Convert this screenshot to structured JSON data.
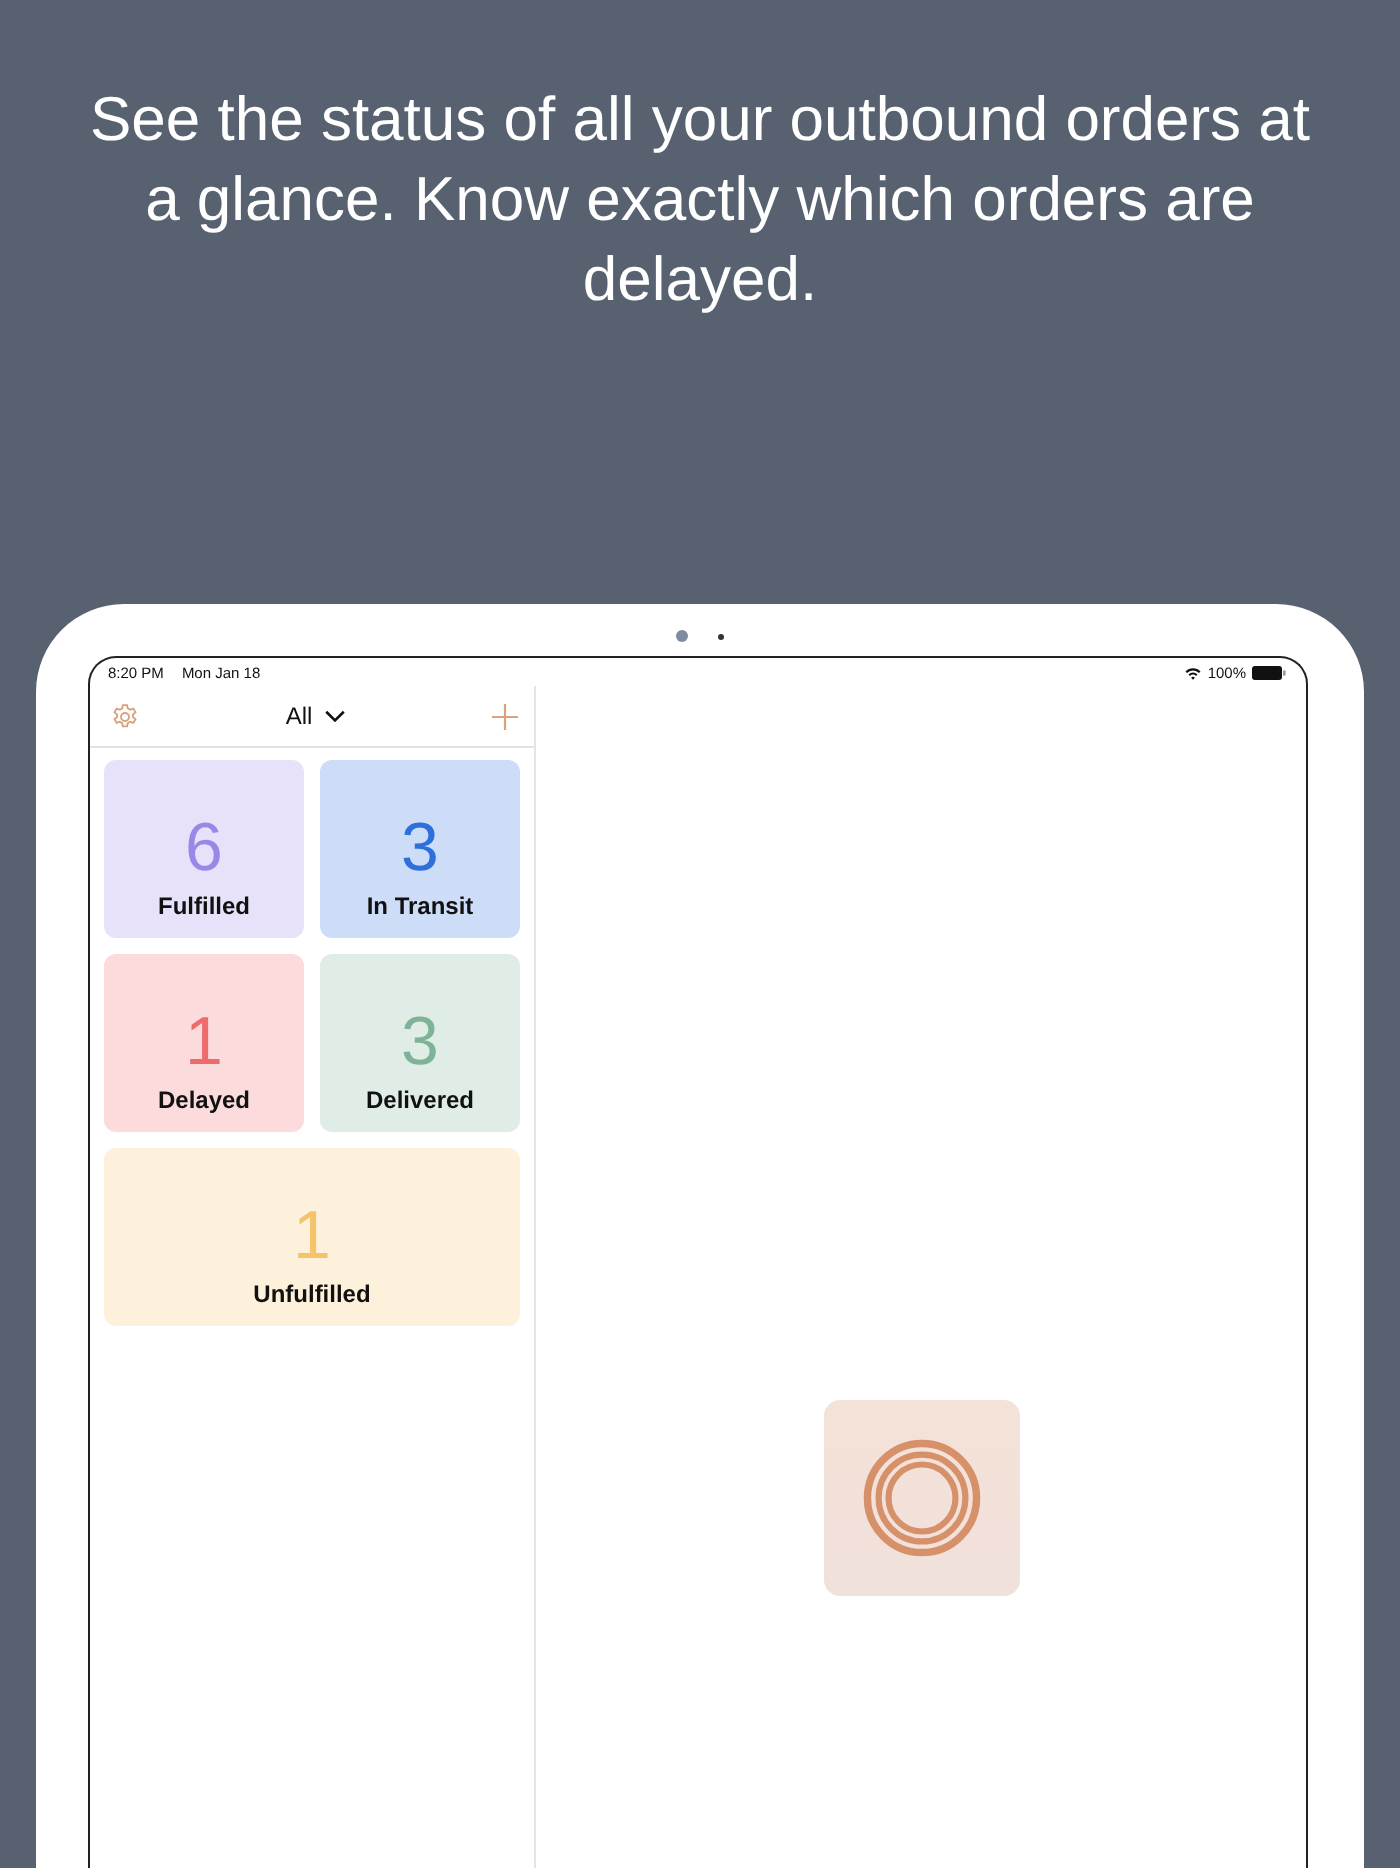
{
  "headline": "See the status of all your outbound orders at a glance. Know exactly which orders are delayed.",
  "status_bar": {
    "time": "8:20 PM",
    "date": "Mon Jan 18",
    "battery": "100%"
  },
  "nav": {
    "title": "All"
  },
  "tiles": [
    {
      "count": "6",
      "label": "Fulfilled",
      "color": "#9b87e8",
      "kind": "half"
    },
    {
      "count": "3",
      "label": "In Transit",
      "color": "#2f6fdc",
      "kind": "half"
    },
    {
      "count": "1",
      "label": "Delayed",
      "color": "#ee6b6b",
      "kind": "half"
    },
    {
      "count": "3",
      "label": "Delivered",
      "color": "#7fb398",
      "kind": "half"
    },
    {
      "count": "1",
      "label": "Unfulfilled",
      "color": "#f5c36a",
      "kind": "wide"
    }
  ]
}
